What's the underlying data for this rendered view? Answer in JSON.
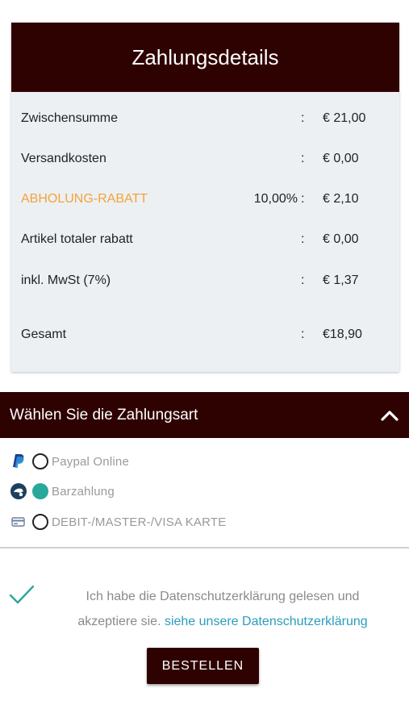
{
  "summary": {
    "title": "Zahlungsdetails",
    "rows": [
      {
        "label": "Zwischensumme",
        "pct": "",
        "colon": ":",
        "value": "€ 21,00"
      },
      {
        "label": "Versandkosten",
        "pct": "",
        "colon": ":",
        "value": "€ 0,00"
      },
      {
        "label": "ABHOLUNG-RABATT",
        "pct": "10,00%",
        "colon": ":",
        "value": "€ 2,10"
      },
      {
        "label": "Artikel totaler rabatt",
        "pct": "",
        "colon": ":",
        "value": "€ 0,00"
      },
      {
        "label": "inkl. MwSt (7%)",
        "pct": "",
        "colon": ":",
        "value": "€ 1,37"
      },
      {
        "label": "Gesamt",
        "pct": "",
        "colon": ":",
        "value": "€18,90"
      }
    ]
  },
  "payment": {
    "title": "Wählen Sie die Zahlungsart",
    "options": [
      {
        "label": "Paypal Online",
        "icon": "paypal-icon",
        "selected": false
      },
      {
        "label": "Barzahlung",
        "icon": "cash-icon",
        "selected": true
      },
      {
        "label": "DEBIT-/MASTER-/VISA KARTE",
        "icon": "credit-card-icon",
        "selected": false
      }
    ]
  },
  "consent": {
    "text": "Ich habe die Datenschutzerklärung gelesen und akzeptiere sie.",
    "link": "siehe unsere Datenschutzerklärung"
  },
  "order_button": "BESTELLEN",
  "colors": {
    "header_bg": "#2f0202",
    "discount": "#f2a33a",
    "selected_radio": "#2aa79b",
    "link": "#2a9dbd"
  }
}
